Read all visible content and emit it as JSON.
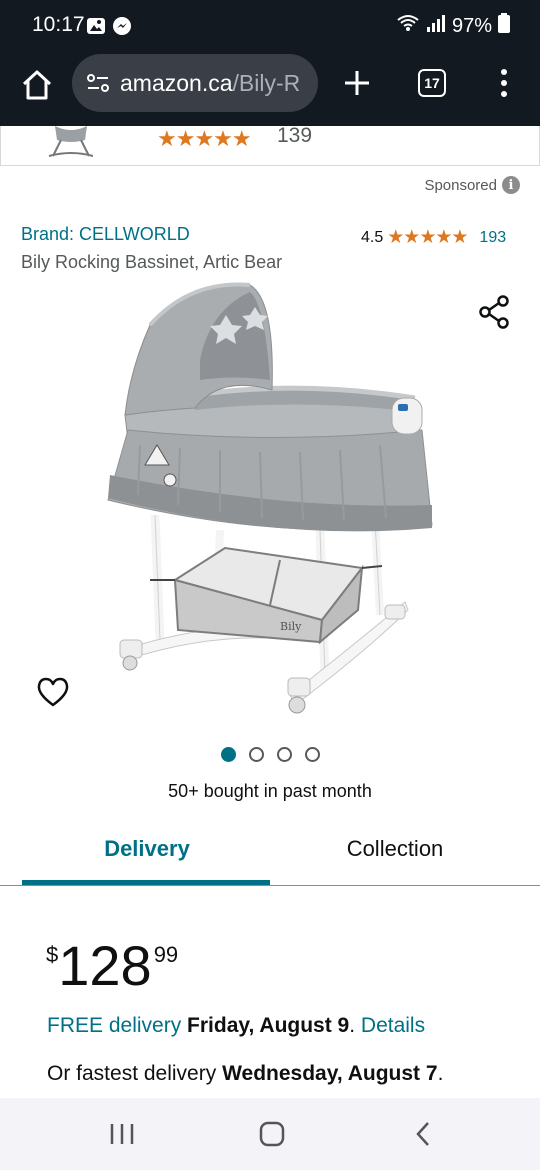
{
  "status_bar": {
    "time": "10:17",
    "battery": "97%",
    "left_icons": [
      "gallery-icon",
      "messenger-icon"
    ],
    "right_icons": [
      "wifi-icon",
      "signal-icon",
      "battery-icon"
    ]
  },
  "browser": {
    "url_host": "amazon.ca",
    "url_path": "/Bily-R",
    "tab_count": "17"
  },
  "previous_item": {
    "rating_stars": "★★★★★",
    "review_count": "139"
  },
  "sponsored": {
    "label": "Sponsored",
    "info_glyph": "i"
  },
  "product": {
    "brand": "Brand: CELLWORLD",
    "rating": "4.5",
    "rating_stars": "★★★★★",
    "review_count": "193",
    "title": "Bily Rocking Bassinet, Artic Bear",
    "image_count": 4,
    "active_image": 1,
    "bought_text": "50+ bought in past month"
  },
  "tabs": {
    "delivery": "Delivery",
    "collection": "Collection",
    "active": "delivery"
  },
  "price": {
    "symbol": "$",
    "whole": "128",
    "fraction": "99"
  },
  "delivery_info": {
    "free_label": "FREE delivery",
    "free_date": "Friday, August 9",
    "details": "Details",
    "fastest_prefix": "Or fastest delivery",
    "fastest_date": "Wednesday, August 7"
  },
  "colors": {
    "link": "#007185",
    "star": "#de7921",
    "header": "#131921"
  }
}
